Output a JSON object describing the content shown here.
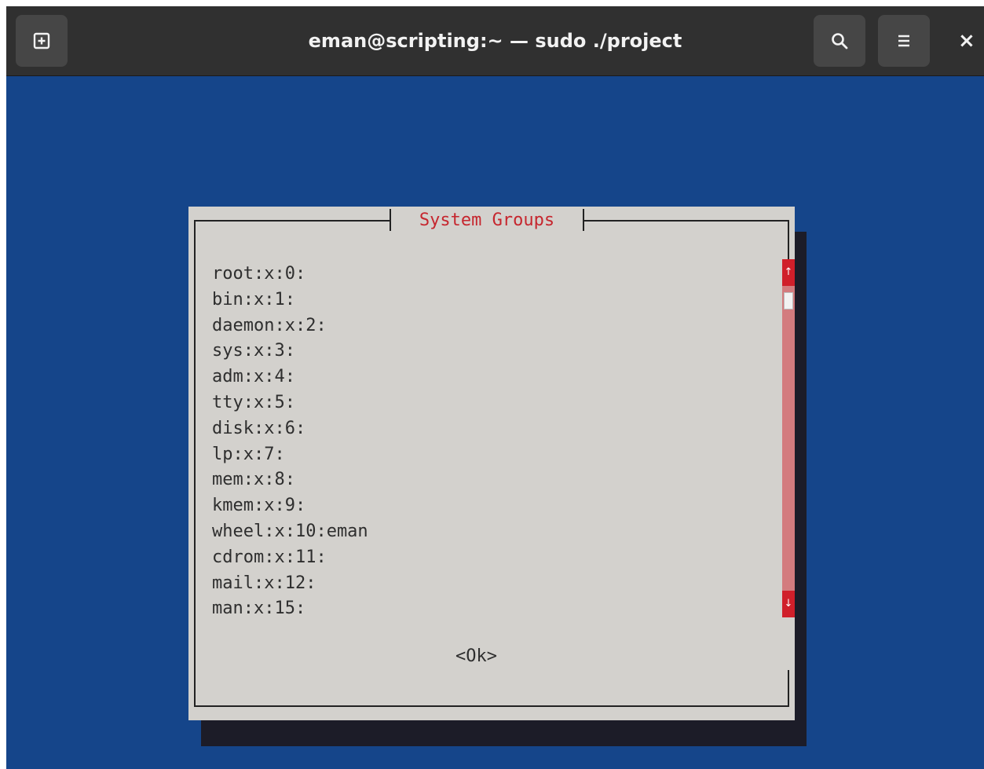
{
  "window": {
    "title": "eman@scripting:~ — sudo ./project",
    "new_tab_icon": "new-tab-icon",
    "search_icon": "search-icon",
    "menu_icon": "hamburger-menu-icon",
    "close_label": "×"
  },
  "dialog": {
    "title": "System Groups",
    "groups": [
      "root:x:0:",
      "bin:x:1:",
      "daemon:x:2:",
      "sys:x:3:",
      "adm:x:4:",
      "tty:x:5:",
      "disk:x:6:",
      "lp:x:7:",
      "mem:x:8:",
      "kmem:x:9:",
      "wheel:x:10:eman",
      "cdrom:x:11:",
      "mail:x:12:",
      "man:x:15:"
    ],
    "scroll_up_label": "↑",
    "scroll_down_label": "↓",
    "ok_label": "<Ok>"
  },
  "colors": {
    "terminal_background": "#15458a",
    "dialog_background": "#d3d1cd",
    "title_accent": "#c6262e",
    "scrollbar_track": "#d37b7e",
    "scrollbar_arrow": "#d01f2a"
  }
}
